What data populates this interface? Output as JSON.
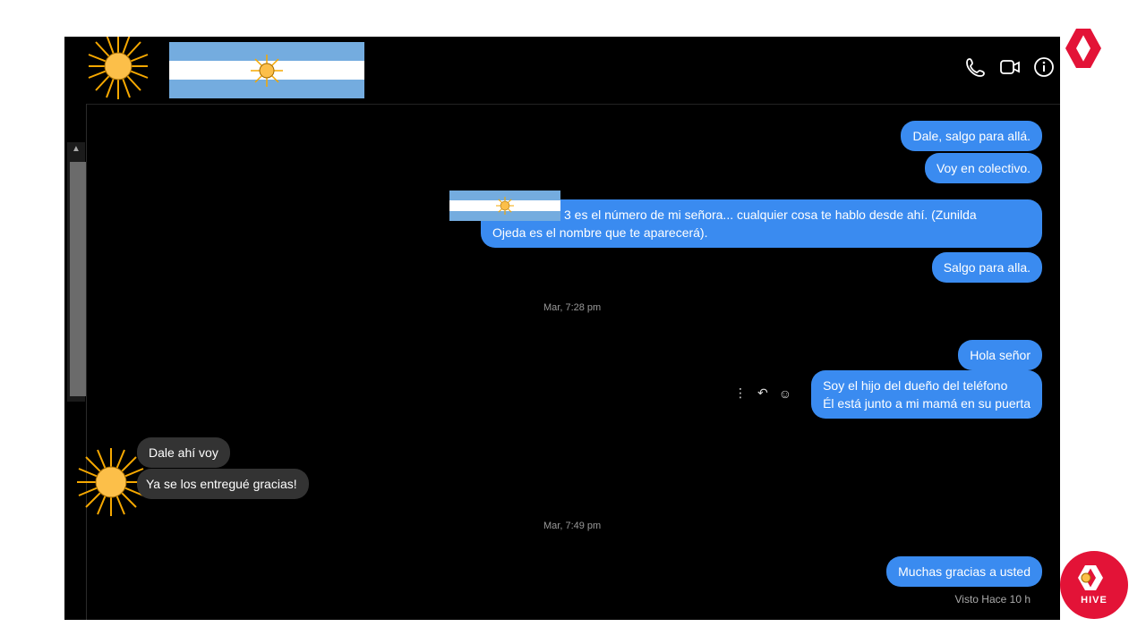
{
  "chat": {
    "messages": [
      {
        "text": "Dale, salgo para allá."
      },
      {
        "text": "Voy en colectivo."
      },
      {
        "text": "3 es el  número de mi señora... cualquier cosa te hablo desde ahí. (Zunilda",
        "text2": "Ojeda es el nombre que te aparecerá)."
      },
      {
        "text": "Salgo para alla."
      },
      {
        "text": "Hola señor"
      },
      {
        "text": "Soy el hijo del dueño del teléfono",
        "text2": "Él está junto a mi mamá en su puerta"
      },
      {
        "text": "Dale ahí voy"
      },
      {
        "text": "Ya se los entregué gracias!"
      },
      {
        "text": "Muchas gracias a usted"
      }
    ],
    "timestamps": [
      "Mar, 7:28 pm",
      "Mar, 7:49 pm"
    ],
    "seen": "Visto Hace 10 h"
  },
  "header": {
    "icons": [
      "phone-icon",
      "video-icon",
      "info-icon"
    ]
  },
  "branding": {
    "badge_text": "HIVE",
    "accent": "#e31337",
    "bubble_out": "#3a8bf0",
    "bubble_in": "#333333"
  }
}
